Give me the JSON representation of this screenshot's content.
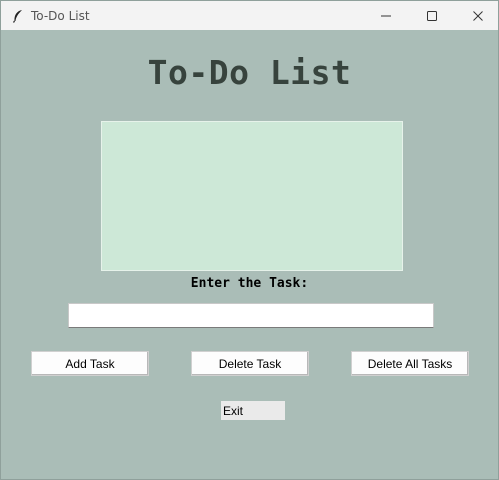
{
  "window": {
    "title": "To-Do List",
    "icons": {
      "app": "feather-icon",
      "minimize": "minimize-icon",
      "maximize": "maximize-icon",
      "close": "close-icon"
    }
  },
  "main": {
    "heading": "To-Do List",
    "tasks": [],
    "task_label": "Enter the Task:",
    "task_input": {
      "value": "",
      "placeholder": ""
    },
    "buttons": {
      "add": "Add Task",
      "delete": "Delete Task",
      "delete_all": "Delete All Tasks",
      "exit": "Exit"
    }
  },
  "colors": {
    "background": "#aabdb7",
    "listbox": "#cde8d7",
    "heading": "#37433d",
    "titlebar": "#f3f3f3"
  }
}
